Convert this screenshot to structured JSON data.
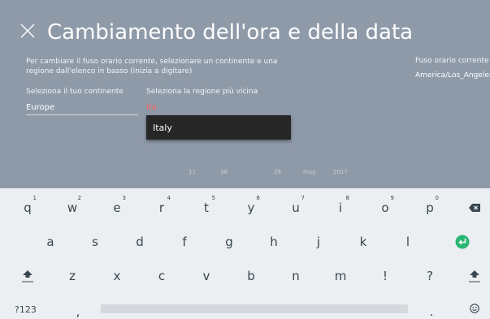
{
  "header": {
    "title": "Cambiamento dell'ora e della data",
    "close_icon": "close-icon"
  },
  "description": "Per cambiare il fuso orario corrente, selezionare un continente e una regione dall'elenco in basso (inizia a digitare)",
  "timezone": {
    "label": "Fuso orario corrente",
    "value": "America/Los_Angeles"
  },
  "continent": {
    "label": "Seleziona il tuo continente",
    "value": "Europe"
  },
  "region": {
    "label": "Seleziona la regione più vicina",
    "value": "ita"
  },
  "suggestions": [
    "Italy"
  ],
  "faded_date": {
    "hour": "11",
    "minute": "38",
    "day": "28",
    "month": "mag",
    "year": "2017"
  },
  "keyboard": {
    "row1": [
      {
        "k": "q",
        "h": "1"
      },
      {
        "k": "w",
        "h": "2"
      },
      {
        "k": "e",
        "h": "3"
      },
      {
        "k": "r",
        "h": "4"
      },
      {
        "k": "t",
        "h": "5"
      },
      {
        "k": "y",
        "h": "6"
      },
      {
        "k": "u",
        "h": "7"
      },
      {
        "k": "i",
        "h": "8"
      },
      {
        "k": "o",
        "h": "9"
      },
      {
        "k": "p",
        "h": "0"
      }
    ],
    "row2": [
      "a",
      "s",
      "d",
      "f",
      "g",
      "h",
      "j",
      "k",
      "l"
    ],
    "row3": [
      "z",
      "x",
      "c",
      "v",
      "b",
      "n",
      "m",
      "!",
      "?"
    ],
    "symbols_label": "?123",
    "comma": ",",
    "period": ".",
    "icons": {
      "backspace": "backspace-icon",
      "enter": "enter-icon",
      "shift": "shift-icon",
      "emoji": "emoji-icon"
    },
    "accent_color": "#2bb673"
  }
}
